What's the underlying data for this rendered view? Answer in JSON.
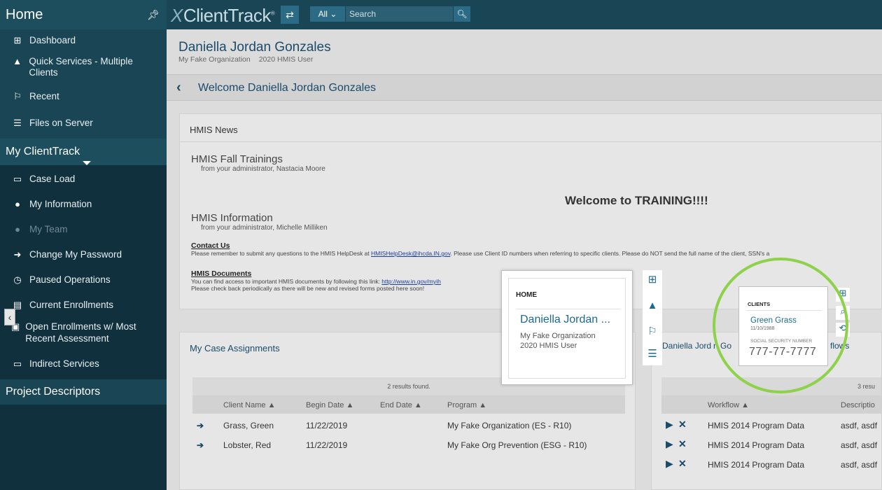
{
  "sidebar": {
    "home_label": "Home",
    "items_top": [
      {
        "label": "Dashboard",
        "icon": "map-icon"
      },
      {
        "label": "Quick Services - Multiple Clients",
        "icon": "bell-icon"
      },
      {
        "label": "Recent",
        "icon": "flag-icon"
      },
      {
        "label": "Files on Server",
        "icon": "checklist-icon"
      }
    ],
    "section_myct": "My ClientTrack",
    "items_myct": [
      {
        "label": "Case Load",
        "icon": "folder-icon"
      },
      {
        "label": "My Information",
        "icon": "user-icon"
      },
      {
        "label": "My Team",
        "icon": "team-icon"
      },
      {
        "label": "Change My Password",
        "icon": "arrow-circle-icon"
      },
      {
        "label": "Paused Operations",
        "icon": "clock-icon"
      },
      {
        "label": "Current Enrollments",
        "icon": "document-icon"
      },
      {
        "label": "Open Enrollments w/ Most Recent Assessment",
        "icon": "id-card-icon"
      },
      {
        "label": "Indirect Services",
        "icon": "folder-icon"
      }
    ],
    "section_pd": "Project Descriptors"
  },
  "topbar": {
    "logo": "ClientTrack",
    "logo_mark": "X",
    "filter_label": "All",
    "search_placeholder": "Search"
  },
  "user": {
    "name": "Daniella Jordan Gonzales",
    "org": "My Fake Organization",
    "role": "2020 HMIS User"
  },
  "welcome_title": "Welcome Daniella Jordan Gonzales",
  "news": {
    "header": "HMIS News",
    "item1_title": "HMIS Fall Trainings",
    "item1_from": "from your administrator, Nastacia Moore",
    "training": "Welcome to TRAINING!!!!",
    "item2_title": "HMIS Information",
    "item2_from": "from your administrator, Michelle Milliken",
    "contact_head": "Contact Us",
    "contact_pre": "Please remember to submit any questions to the HMIS HelpDesk at ",
    "contact_link": "HMISHelpDesk@ihcda.IN.gov",
    "contact_post": ".  Please use Client ID numbers when referring to specific clients.  Please do NOT send the full name of the client, SSN's a",
    "docs_head": "HMIS Documents",
    "docs_pre": "You can find access to important HMIS documents by following this link:  ",
    "docs_link": "http://www.in.gov/myih",
    "docs_line2": "Please check back periodically as there will be new and revised forms posted here soon!"
  },
  "case_assignments": {
    "title": "My Case Assignments",
    "found": "2 results found.",
    "headers": {
      "client": "Client Name ▲",
      "begin": "Begin Date ▲",
      "end": "End Date ▲",
      "program": "Program ▲"
    },
    "rows": [
      {
        "client": "Grass, Green",
        "begin": "11/22/2019",
        "end": "",
        "program": "My Fake Organization (ES - R10)"
      },
      {
        "client": "Lobster, Red",
        "begin": "11/22/2019",
        "end": "",
        "program": "My Fake Org Prevention (ESG - R10)"
      }
    ]
  },
  "workflows": {
    "title_frag1": "Daniella Jord",
    "title_frag2": "n Go",
    "title_frag3": "flows",
    "found": "3 resu",
    "headers": {
      "workflow": "Workflow ▲",
      "description": "Descriptio"
    },
    "rows": [
      {
        "workflow": "HMIS 2014 Program Data",
        "description": "asdf, asdf"
      },
      {
        "workflow": "HMIS 2014 Program Data",
        "description": "asdf, asdf"
      },
      {
        "workflow": "HMIS 2014 Program Data",
        "description": "asdf, asdf"
      }
    ]
  },
  "home_popup": {
    "heading": "HOME",
    "name": "Daniella Jordan ...",
    "org": "My Fake Organization",
    "role": "2020 HMIS User"
  },
  "client_popup": {
    "heading": "CLIENTS",
    "name": "Green Grass",
    "dob": "11/10/1988",
    "ssn_label": "SOCIAL SECURITY NUMBER",
    "ssn": "777-77-7777"
  },
  "colors": {
    "sidebar": "#10303d",
    "topbar": "#1a4555",
    "accent": "#1b6a8f",
    "highlight": "#8ed14a"
  }
}
